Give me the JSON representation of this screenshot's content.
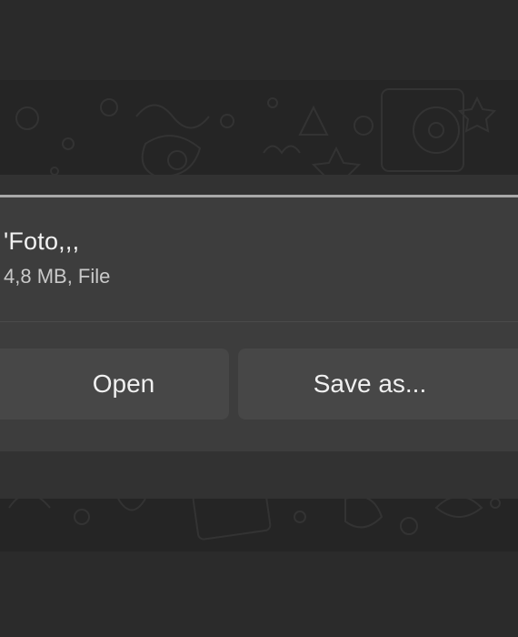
{
  "attachment": {
    "file_name": "'Foto,,,",
    "file_meta": "4,8 MB, File"
  },
  "actions": {
    "open_label": "Open",
    "save_as_label": "Save as..."
  },
  "colors": {
    "panel_background": "#3d3d3d",
    "button_background": "#474747",
    "top_border": "#a9a9a9",
    "chat_background": "#252525"
  }
}
